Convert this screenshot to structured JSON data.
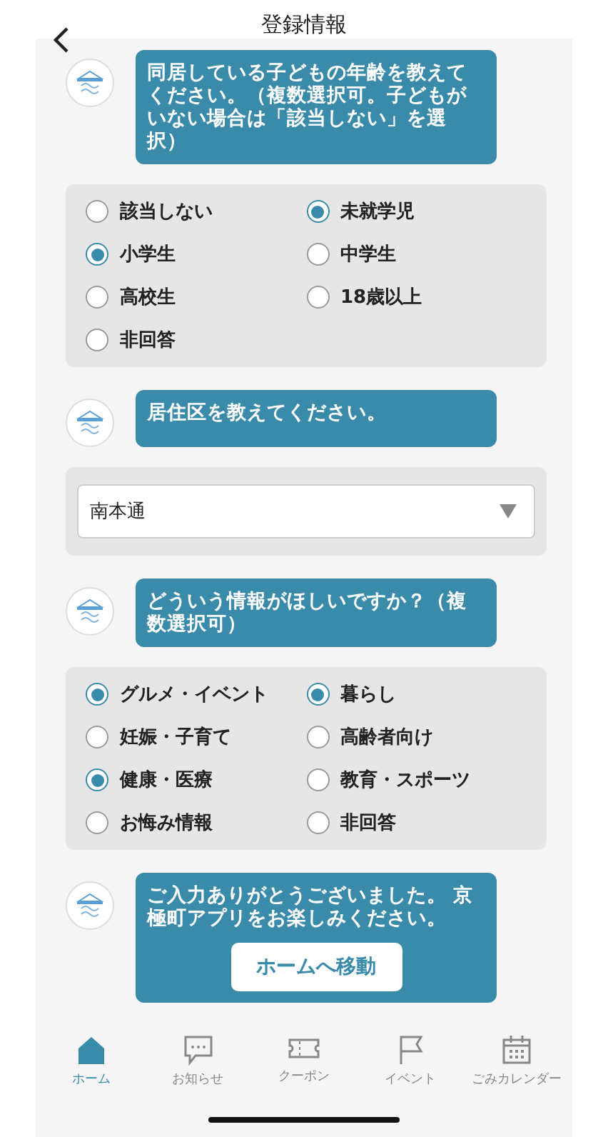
{
  "header": {
    "title": "登録情報"
  },
  "messages": [
    {
      "text": "同居している子どもの年齢を教えてください。（複数選択可。子どもがいない場合は「該当しない」を選択）",
      "answer": {
        "kind": "radios",
        "options": [
          {
            "label": "該当しない",
            "selected": false
          },
          {
            "label": "未就学児",
            "selected": true
          },
          {
            "label": "小学生",
            "selected": true
          },
          {
            "label": "中学生",
            "selected": false
          },
          {
            "label": "高校生",
            "selected": false
          },
          {
            "label": "18歳以上",
            "selected": false
          },
          {
            "label": "非回答",
            "selected": false
          }
        ]
      }
    },
    {
      "text": "居住区を教えてください。",
      "answer": {
        "kind": "select",
        "value": "南本通"
      }
    },
    {
      "text": "どういう情報がほしいですか？（複数選択可）",
      "answer": {
        "kind": "radios",
        "options": [
          {
            "label": "グルメ・イベント",
            "selected": true
          },
          {
            "label": "暮らし",
            "selected": true
          },
          {
            "label": "妊娠・子育て",
            "selected": false
          },
          {
            "label": "高齢者向け",
            "selected": false
          },
          {
            "label": "健康・医療",
            "selected": true
          },
          {
            "label": "教育・スポーツ",
            "selected": false
          },
          {
            "label": "お悔み情報",
            "selected": false
          },
          {
            "label": "非回答",
            "selected": false
          }
        ]
      }
    },
    {
      "text": "ご入力ありがとうございました。 京極町アプリをお楽しみください。",
      "button": "ホームへ移動"
    }
  ],
  "nav": [
    {
      "label": "ホーム",
      "selected": true
    },
    {
      "label": "お知らせ",
      "selected": false
    },
    {
      "label": "クーポン",
      "selected": false
    },
    {
      "label": "イベント",
      "selected": false
    },
    {
      "label": "ごみカレンダー",
      "selected": false
    }
  ]
}
